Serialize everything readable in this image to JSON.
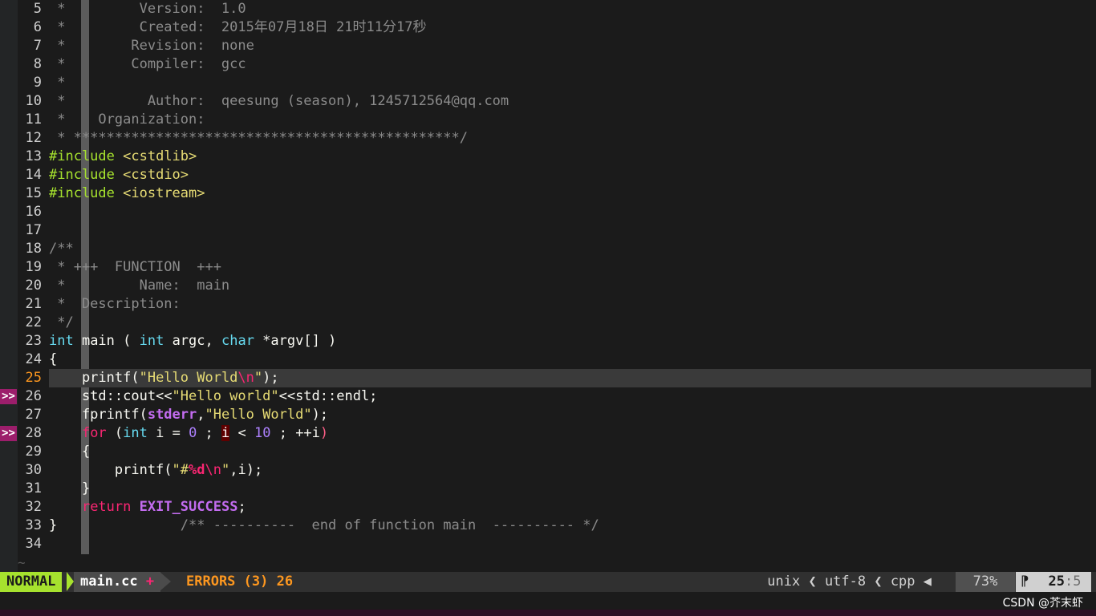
{
  "editor": {
    "lines": [
      {
        "n": "5",
        "segs": [
          {
            "t": " *         Version:  1.0",
            "c": "c-comment"
          }
        ]
      },
      {
        "n": "6",
        "segs": [
          {
            "t": " *         Created:  2015年07月18日 21时11分17秒",
            "c": "c-comment"
          }
        ]
      },
      {
        "n": "7",
        "segs": [
          {
            "t": " *        Revision:  none",
            "c": "c-comment"
          }
        ]
      },
      {
        "n": "8",
        "segs": [
          {
            "t": " *        Compiler:  gcc",
            "c": "c-comment"
          }
        ]
      },
      {
        "n": "9",
        "segs": [
          {
            "t": " *",
            "c": "c-comment"
          }
        ]
      },
      {
        "n": "10",
        "segs": [
          {
            "t": " *          Author:  qeesung (season), 1245712564@qq.com",
            "c": "c-comment"
          }
        ]
      },
      {
        "n": "11",
        "segs": [
          {
            "t": " *    Organization:",
            "c": "c-comment"
          }
        ]
      },
      {
        "n": "12",
        "segs": [
          {
            "t": " * ***********************************************/",
            "c": "c-comment"
          }
        ]
      },
      {
        "n": "13",
        "segs": [
          {
            "t": "#include",
            "c": "c-pre"
          },
          {
            "t": " ",
            "c": "c-plain"
          },
          {
            "t": "<cstdlib>",
            "c": "c-inc"
          }
        ]
      },
      {
        "n": "14",
        "segs": [
          {
            "t": "#include",
            "c": "c-pre"
          },
          {
            "t": " ",
            "c": "c-plain"
          },
          {
            "t": "<cstdio>",
            "c": "c-inc"
          }
        ]
      },
      {
        "n": "15",
        "segs": [
          {
            "t": "#include",
            "c": "c-pre"
          },
          {
            "t": " ",
            "c": "c-plain"
          },
          {
            "t": "<iostream>",
            "c": "c-inc"
          }
        ]
      },
      {
        "n": "16",
        "segs": []
      },
      {
        "n": "17",
        "segs": []
      },
      {
        "n": "18",
        "segs": [
          {
            "t": "/**",
            "c": "c-comment"
          }
        ]
      },
      {
        "n": "19",
        "segs": [
          {
            "t": " * +++  FUNCTION  +++",
            "c": "c-comment"
          }
        ]
      },
      {
        "n": "20",
        "segs": [
          {
            "t": " *         Name:  main",
            "c": "c-comment"
          }
        ]
      },
      {
        "n": "21",
        "segs": [
          {
            "t": " *  Description:",
            "c": "c-comment"
          }
        ]
      },
      {
        "n": "22",
        "segs": [
          {
            "t": " */",
            "c": "c-comment"
          }
        ]
      },
      {
        "n": "23",
        "segs": [
          {
            "t": "int",
            "c": "c-type"
          },
          {
            "t": " main ( ",
            "c": "c-plain"
          },
          {
            "t": "int",
            "c": "c-type"
          },
          {
            "t": " argc, ",
            "c": "c-plain"
          },
          {
            "t": "char",
            "c": "c-type"
          },
          {
            "t": " *argv[] )",
            "c": "c-plain"
          }
        ]
      },
      {
        "n": "24",
        "segs": [
          {
            "t": "{",
            "c": "c-plain"
          }
        ]
      },
      {
        "n": "25",
        "cur": true,
        "segs": [
          {
            "t": "    printf(",
            "c": "c-plain"
          },
          {
            "t": "\"Hello World",
            "c": "c-str"
          },
          {
            "t": "\\n",
            "c": "c-esc"
          },
          {
            "t": "\"",
            "c": "c-str"
          },
          {
            "t": ");",
            "c": "c-plain"
          }
        ]
      },
      {
        "n": "26",
        "sign": ">>",
        "segs": [
          {
            "t": "    std::cout<<",
            "c": "c-plain"
          },
          {
            "t": "\"Hello world\"",
            "c": "c-str"
          },
          {
            "t": "<<std::endl;",
            "c": "c-plain"
          }
        ]
      },
      {
        "n": "27",
        "segs": [
          {
            "t": "    fprintf(",
            "c": "c-plain"
          },
          {
            "t": "stderr",
            "c": "c-const"
          },
          {
            "t": ",",
            "c": "c-plain"
          },
          {
            "t": "\"Hello World\"",
            "c": "c-str"
          },
          {
            "t": ");",
            "c": "c-plain"
          }
        ]
      },
      {
        "n": "28",
        "sign": ">>",
        "segs": [
          {
            "t": "    ",
            "c": "c-plain"
          },
          {
            "t": "for",
            "c": "c-key"
          },
          {
            "t": " (",
            "c": "c-plain"
          },
          {
            "t": "int",
            "c": "c-type"
          },
          {
            "t": " i = ",
            "c": "c-plain"
          },
          {
            "t": "0",
            "c": "c-num"
          },
          {
            "t": " ; ",
            "c": "c-plain"
          },
          {
            "t": "i",
            "c": "err"
          },
          {
            "t": " < ",
            "c": "c-plain"
          },
          {
            "t": "10",
            "c": "c-num"
          },
          {
            "t": " ; ++i",
            "c": "c-plain"
          },
          {
            "t": ")",
            "c": "err-close"
          }
        ]
      },
      {
        "n": "29",
        "segs": [
          {
            "t": "    {",
            "c": "c-plain"
          }
        ]
      },
      {
        "n": "30",
        "segs": [
          {
            "t": "        printf(",
            "c": "c-plain"
          },
          {
            "t": "\"#",
            "c": "c-str"
          },
          {
            "t": "%d",
            "c": "c-fmt"
          },
          {
            "t": "\\n",
            "c": "c-esc"
          },
          {
            "t": "\"",
            "c": "c-str"
          },
          {
            "t": ",i);",
            "c": "c-plain"
          }
        ]
      },
      {
        "n": "31",
        "segs": [
          {
            "t": "    }",
            "c": "c-plain"
          }
        ]
      },
      {
        "n": "32",
        "segs": [
          {
            "t": "    ",
            "c": "c-plain"
          },
          {
            "t": "return",
            "c": "c-key"
          },
          {
            "t": " ",
            "c": "c-plain"
          },
          {
            "t": "EXIT_SUCCESS",
            "c": "c-const"
          },
          {
            "t": ";",
            "c": "c-plain"
          }
        ]
      },
      {
        "n": "33",
        "segs": [
          {
            "t": "}",
            "c": "c-plain"
          },
          {
            "t": "               /** ----------  end of function main  ---------- */",
            "c": "c-comment"
          }
        ]
      },
      {
        "n": "34",
        "segs": []
      }
    ],
    "filler": "~"
  },
  "status": {
    "mode": "NORMAL",
    "file": "main.cc",
    "modified": "+",
    "errors": "ERRORS (3)  26",
    "right": "unix ❮ utf-8 ❮ cpp ◀",
    "percent": "73%",
    "pos_icon": "⁋",
    "pos_line": "25",
    "pos_sep": ":",
    "pos_col": "5"
  },
  "watermark": "CSDN @芥末虾",
  "colors": {
    "mode_bg": "#a6e22e",
    "sign_bg": "#9c1e6b",
    "accent": "#fd971f"
  }
}
